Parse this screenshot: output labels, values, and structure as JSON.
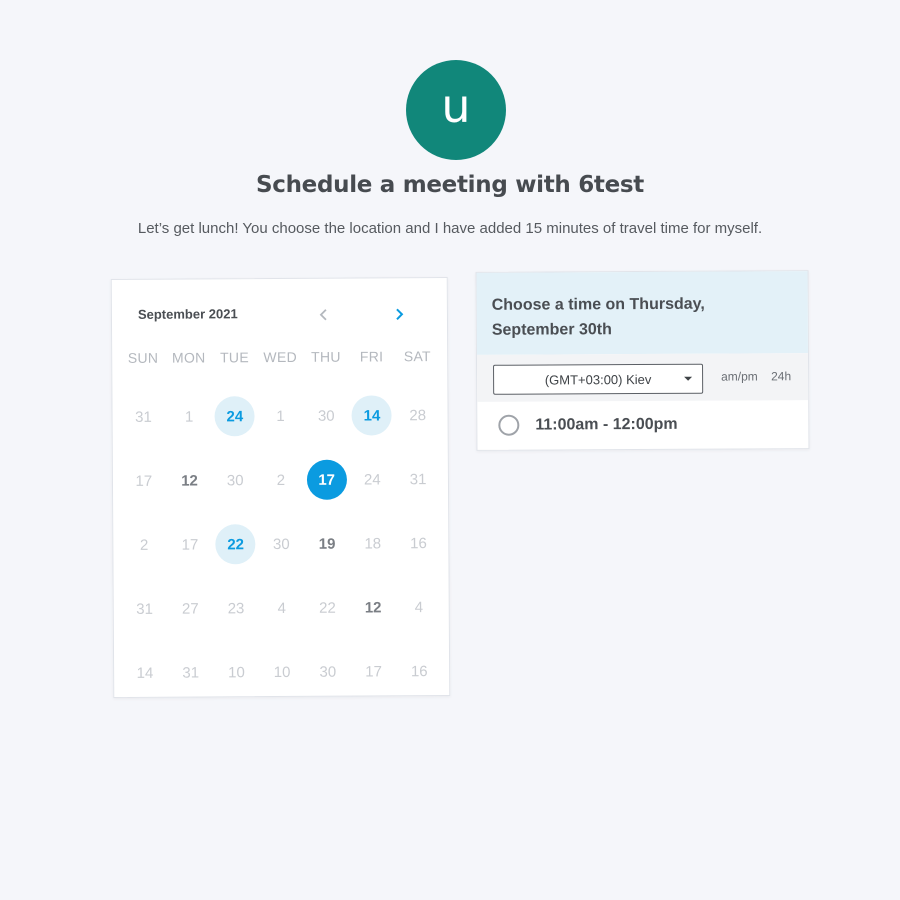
{
  "avatar": {
    "initial": "u",
    "color": "#11877a"
  },
  "header": {
    "title": "Schedule a meeting with 6test",
    "subtitle": "Let’s get lunch! You choose the location and I have added 15 minutes of travel time for myself."
  },
  "calendar": {
    "month_label": "September 2021",
    "prev_icon": "chevron-left-icon",
    "next_icon": "chevron-right-icon",
    "weekdays": [
      "SUN",
      "MON",
      "TUE",
      "WED",
      "THU",
      "FRI",
      "SAT"
    ],
    "weeks": [
      [
        {
          "d": "31",
          "s": "dim"
        },
        {
          "d": "1",
          "s": "dim"
        },
        {
          "d": "24",
          "s": "avail"
        },
        {
          "d": "1",
          "s": "dim"
        },
        {
          "d": "30",
          "s": "dim"
        },
        {
          "d": "14",
          "s": "avail"
        },
        {
          "d": "28",
          "s": "dim"
        }
      ],
      [
        {
          "d": "17",
          "s": "dim"
        },
        {
          "d": "12",
          "s": "bold"
        },
        {
          "d": "30",
          "s": "dim"
        },
        {
          "d": "2",
          "s": "dim"
        },
        {
          "d": "17",
          "s": "sel"
        },
        {
          "d": "24",
          "s": "dim"
        },
        {
          "d": "31",
          "s": "dim"
        }
      ],
      [
        {
          "d": "2",
          "s": "dim"
        },
        {
          "d": "17",
          "s": "dim"
        },
        {
          "d": "22",
          "s": "avail"
        },
        {
          "d": "30",
          "s": "dim"
        },
        {
          "d": "19",
          "s": "bold"
        },
        {
          "d": "18",
          "s": "dim"
        },
        {
          "d": "16",
          "s": "dim"
        }
      ],
      [
        {
          "d": "31",
          "s": "dim"
        },
        {
          "d": "27",
          "s": "dim"
        },
        {
          "d": "23",
          "s": "dim"
        },
        {
          "d": "4",
          "s": "dim"
        },
        {
          "d": "22",
          "s": "dim"
        },
        {
          "d": "12",
          "s": "bold"
        },
        {
          "d": "4",
          "s": "dim"
        }
      ],
      [
        {
          "d": "14",
          "s": "dim"
        },
        {
          "d": "31",
          "s": "dim"
        },
        {
          "d": "10",
          "s": "dim"
        },
        {
          "d": "10",
          "s": "dim"
        },
        {
          "d": "30",
          "s": "dim"
        },
        {
          "d": "17",
          "s": "dim"
        },
        {
          "d": "16",
          "s": "dim"
        }
      ]
    ],
    "colors": {
      "accent": "#0b9be0",
      "available_bg": "#dff0f8"
    }
  },
  "times": {
    "heading": "Choose a time on Thursday, September 30th",
    "timezone": "(GMT+03:00) Kiev",
    "format_ampm": "am/pm",
    "format_24h": "24h",
    "slots": [
      {
        "label": "11:00am - 12:00pm"
      }
    ]
  }
}
